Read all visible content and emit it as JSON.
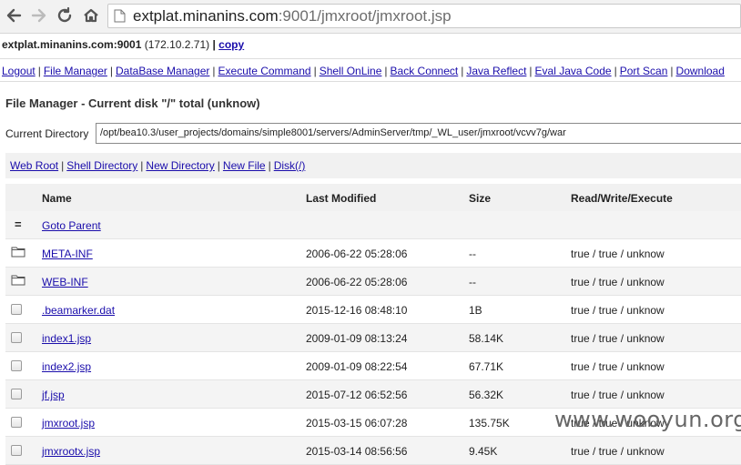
{
  "browser": {
    "url_host": "extplat.minanins.com",
    "url_rest": ":9001/jmxroot/jmxroot.jsp"
  },
  "host": {
    "name": "extplat.minanins.com:9001",
    "ip": "(172.10.2.71)",
    "sep": "|",
    "copy_label": "copy"
  },
  "menu": [
    "Logout",
    "File Manager",
    "DataBase Manager",
    "Execute Command",
    "Shell OnLine",
    "Back Connect",
    "Java Reflect",
    "Eval Java Code",
    "Port Scan",
    "Download"
  ],
  "file_manager": {
    "title": "File Manager - Current disk \"/\" total (unknow)",
    "current_dir_label": "Current Directory",
    "current_dir_value": "/opt/bea10.3/user_projects/domains/simple8001/servers/AdminServer/tmp/_WL_user/jmxroot/vcvv7g/war"
  },
  "links": [
    "Web Root",
    "Shell Directory",
    "New Directory",
    "New File",
    "Disk(/)"
  ],
  "table": {
    "headers": {
      "name": "Name",
      "modified": "Last Modified",
      "size": "Size",
      "rwx": "Read/Write/Execute"
    },
    "parent_icon": "=",
    "parent_label": "Goto Parent",
    "rows": [
      {
        "name": "META-INF",
        "modified": "2006-06-22 05:28:06",
        "size": "--",
        "rwx": "true / true / unknow",
        "type": "folder-icon"
      },
      {
        "name": "WEB-INF",
        "modified": "2006-06-22 05:28:06",
        "size": "--",
        "rwx": "true / true / unknow",
        "type": "folder-icon"
      },
      {
        "name": ".beamarker.dat",
        "modified": "2015-12-16 08:48:10",
        "size": "1B",
        "rwx": "true / true / unknow",
        "type": "checkbox"
      },
      {
        "name": "index1.jsp",
        "modified": "2009-01-09 08:13:24",
        "size": "58.14K",
        "rwx": "true / true / unknow",
        "type": "checkbox"
      },
      {
        "name": "index2.jsp",
        "modified": "2009-01-09 08:22:54",
        "size": "67.71K",
        "rwx": "true / true / unknow",
        "type": "checkbox"
      },
      {
        "name": "jf.jsp",
        "modified": "2015-07-12 06:52:56",
        "size": "56.32K",
        "rwx": "true / true / unknow",
        "type": "checkbox"
      },
      {
        "name": "jmxroot.jsp",
        "modified": "2015-03-15 06:07:28",
        "size": "135.75K",
        "rwx": "true / true / unknow",
        "type": "checkbox"
      },
      {
        "name": "jmxrootx.jsp",
        "modified": "2015-03-14 08:56:56",
        "size": "9.45K",
        "rwx": "true / true / unknow",
        "type": "checkbox"
      }
    ]
  },
  "watermark": "www.wooyun.org",
  "colors": {
    "link": "#1a0dab",
    "row_alt": "#f4f4f4",
    "header_bg": "#f1f1f1"
  }
}
